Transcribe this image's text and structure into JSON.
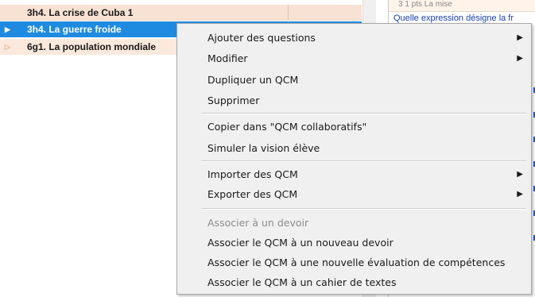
{
  "list": {
    "rows": [
      {
        "label": "3h4. La crise de Cuba 1",
        "arrow": "",
        "selected": false
      },
      {
        "label": "3h4. La guerre froide",
        "arrow": "▶",
        "selected": true
      },
      {
        "label": "6g1. La population mondiale",
        "arrow": "▷",
        "selected": false
      }
    ]
  },
  "detail": {
    "top_text": "3      1 pts      La mise",
    "question": "Quelle expression désigne la fr"
  },
  "context_menu": {
    "items": [
      {
        "label": "Ajouter des questions",
        "submenu": "▶",
        "disabled": false
      },
      {
        "label": "Modifier",
        "submenu": "▶",
        "disabled": false
      },
      {
        "label": "Dupliquer un QCM",
        "submenu": "",
        "disabled": false
      },
      {
        "label": "Supprimer",
        "submenu": "",
        "disabled": false
      },
      {
        "label": "Copier dans \"QCM collaboratifs\"",
        "submenu": "",
        "disabled": false
      },
      {
        "label": "Simuler la vision élève",
        "submenu": "",
        "disabled": false
      },
      {
        "label": "Importer des QCM",
        "submenu": "▶",
        "disabled": false
      },
      {
        "label": "Exporter des QCM",
        "submenu": "▶",
        "disabled": false
      },
      {
        "label": "Associer à un devoir",
        "submenu": "",
        "disabled": true
      },
      {
        "label": "Associer le QCM à un nouveau devoir",
        "submenu": "",
        "disabled": false
      },
      {
        "label": "Associer le QCM à une nouvelle évaluation de compétences",
        "submenu": "",
        "disabled": false
      },
      {
        "label": "Associer le QCM à un cahier de textes",
        "submenu": "",
        "disabled": false
      }
    ]
  },
  "colors": {
    "selection": "#1f8be0",
    "row_bg": "#f8e2d3",
    "link": "#1a3fb4",
    "disabled_text": "#8c8c8c"
  }
}
